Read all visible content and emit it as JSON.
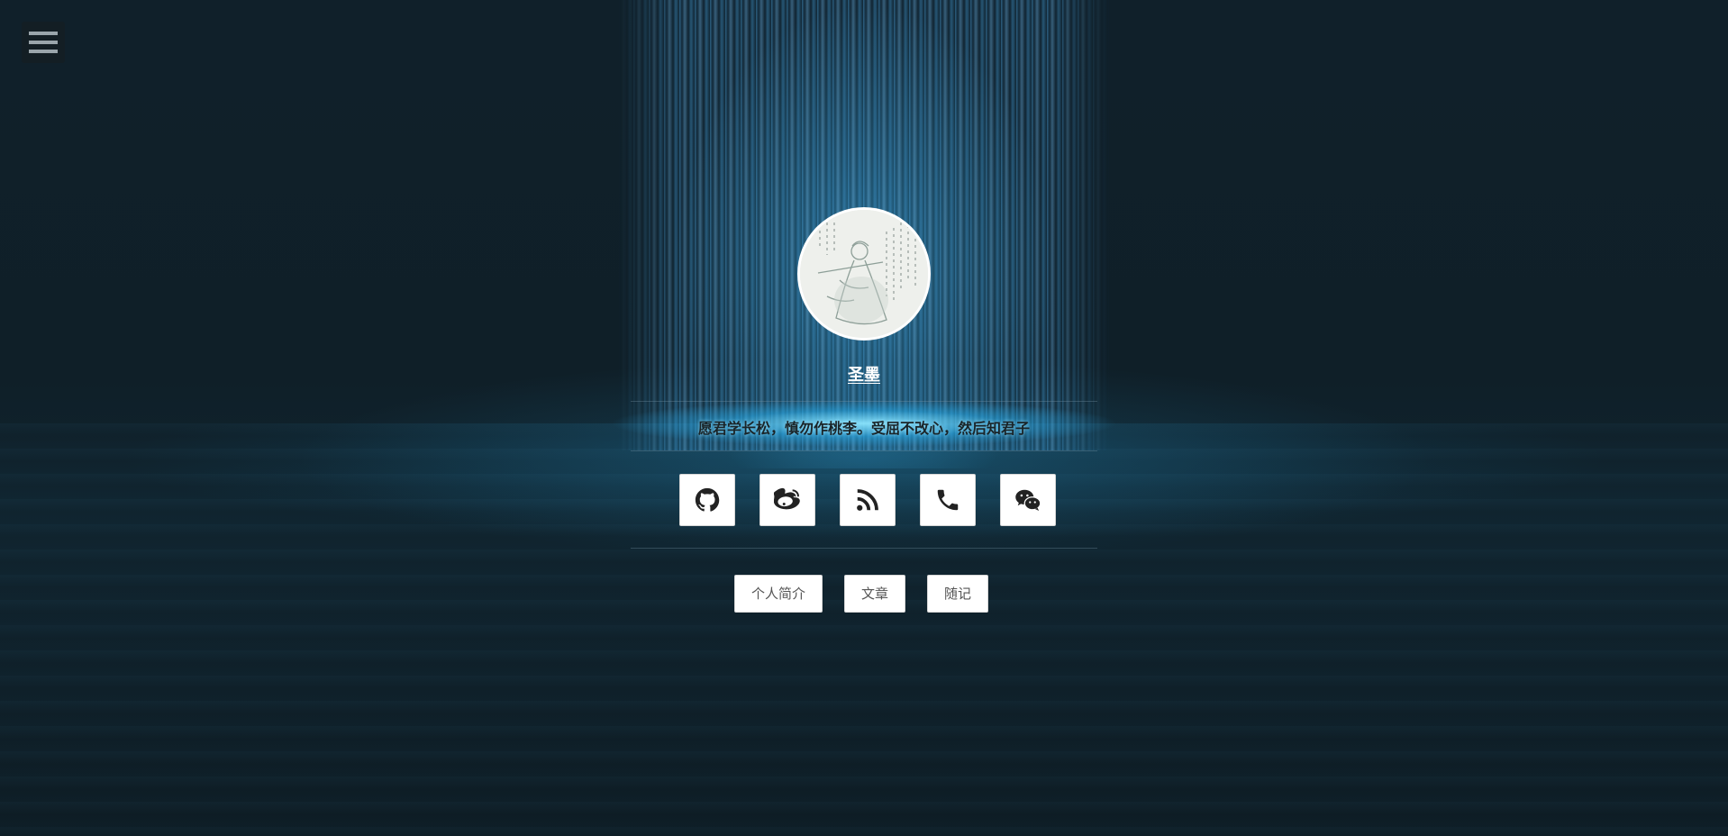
{
  "header": {
    "menu_icon": "hamburger-menu-icon"
  },
  "profile": {
    "name": "圣墨",
    "motto": "愿君学长松，慎勿作桃李。受屈不改心，然后知君子",
    "avatar": "ink-painting-portrait"
  },
  "social_links": [
    {
      "name": "github",
      "icon": "github-icon"
    },
    {
      "name": "weibo",
      "icon": "weibo-icon"
    },
    {
      "name": "rss",
      "icon": "rss-icon"
    },
    {
      "name": "phone",
      "icon": "phone-icon"
    },
    {
      "name": "wechat",
      "icon": "wechat-icon"
    }
  ],
  "nav": {
    "about_label": "个人简介",
    "articles_label": "文章",
    "notes_label": "随记"
  },
  "colors": {
    "background": "#0f1e26",
    "waterfall": "#3fa9e0",
    "button_bg": "#ffffff",
    "icon": "#222222"
  }
}
